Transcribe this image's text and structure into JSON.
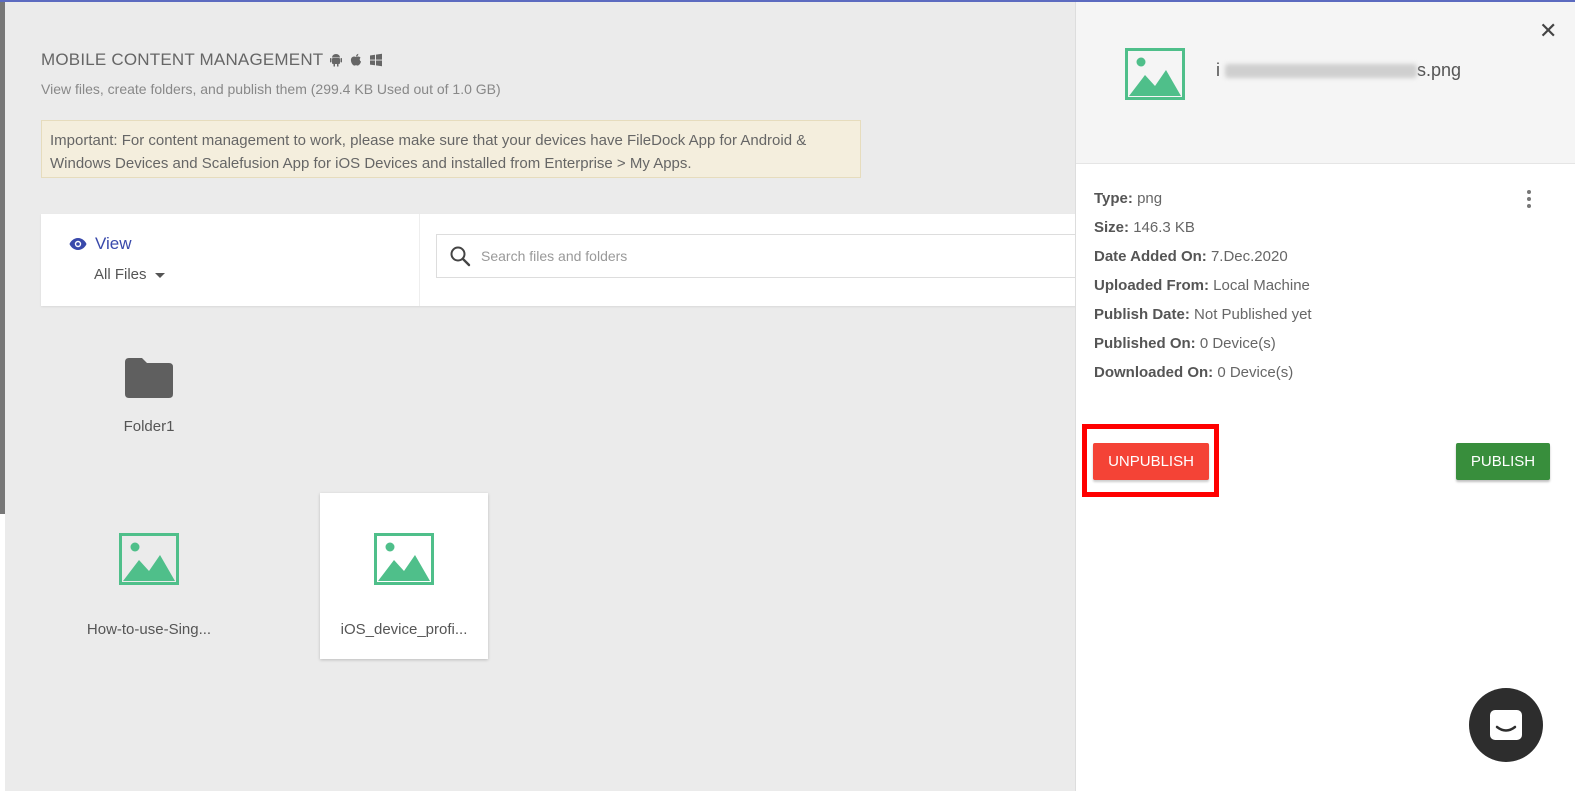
{
  "header": {
    "title": "MOBILE CONTENT MANAGEMENT",
    "os_icons": [
      "android-icon",
      "apple-icon",
      "windows-icon"
    ],
    "subtitle": "View files, create folders, and publish them (299.4 KB Used out of 1.0 GB)",
    "notice": "Important: For content management to work, please make sure that your devices have FileDock App for Android & Windows Devices and Scalefusion App for iOS Devices and installed from Enterprise > My Apps."
  },
  "toolbar": {
    "view_label": "View",
    "filter_value": "All Files",
    "search_placeholder": "Search files and folders"
  },
  "files": [
    {
      "name": "Folder1",
      "icon": "folder-icon"
    },
    {
      "name": "How-to-use-Sing...",
      "icon": "image-file-icon"
    },
    {
      "name": "iOS_device_profi...",
      "icon": "image-file-icon",
      "selected": true
    }
  ],
  "details": {
    "filename_prefix": "i",
    "filename_suffix": "s.png",
    "properties": [
      {
        "label": "Type:",
        "value": "png"
      },
      {
        "label": "Size:",
        "value": "146.3 KB"
      },
      {
        "label": "Date Added On:",
        "value": "7.Dec.2020"
      },
      {
        "label": "Uploaded From:",
        "value": "Local Machine"
      },
      {
        "label": "Publish Date:",
        "value": "Not Published yet"
      },
      {
        "label": "Published On:",
        "value": "0 Device(s)"
      },
      {
        "label": "Downloaded On:",
        "value": "0 Device(s)"
      }
    ],
    "unpublish_label": "UNPUBLISH",
    "publish_label": "PUBLISH"
  },
  "colors": {
    "accent": "#3949ab",
    "unpublish": "#f44336",
    "publish": "#388e3c",
    "image_icon": "#4fbf8a",
    "highlight": "#ff0000"
  }
}
